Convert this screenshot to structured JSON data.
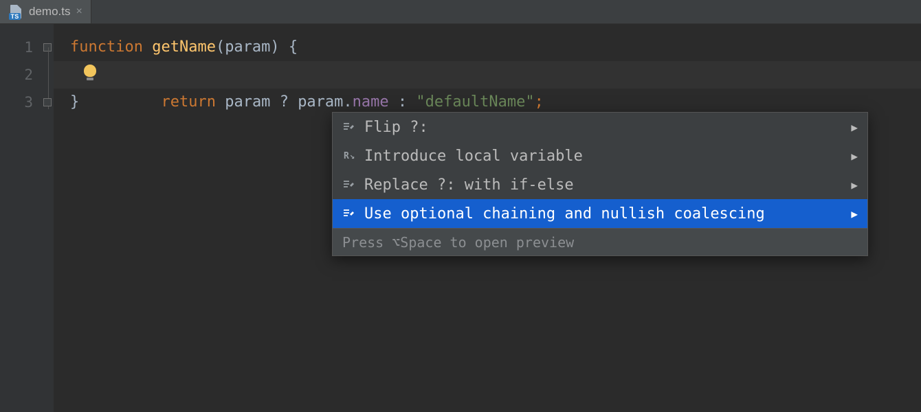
{
  "tab": {
    "filename": "demo.ts",
    "ts_badge": "TS"
  },
  "gutter": {
    "lines": [
      "1",
      "2",
      "3"
    ]
  },
  "code": {
    "line1": {
      "kw_function": "function",
      "fn_name": "getName",
      "paren_open": "(",
      "param": "param",
      "paren_close": ")",
      "brace_open": " {"
    },
    "line2": {
      "indent": "    ",
      "kw_return": "return",
      "sp1": " ",
      "ident_param1": "param",
      "sp2": " ",
      "op_q": "?",
      "sp3": " ",
      "ident_param2": "param",
      "dot": ".",
      "prop_name": "name",
      "sp4": " ",
      "op_colon": ":",
      "sp5": " ",
      "str_default": "\"defaultName\"",
      "semi": ";"
    },
    "line3": {
      "brace_close": "}"
    }
  },
  "popup": {
    "items": [
      {
        "icon": "intent",
        "label": "Flip ?:",
        "has_sub": true,
        "selected": false
      },
      {
        "icon": "refactor",
        "label": "Introduce local variable",
        "has_sub": true,
        "selected": false
      },
      {
        "icon": "intent",
        "label": "Replace ?: with if-else",
        "has_sub": true,
        "selected": false
      },
      {
        "icon": "intent",
        "label": "Use optional chaining and nullish coalescing",
        "has_sub": true,
        "selected": true
      }
    ],
    "hint": "Press ⌥Space to open preview"
  }
}
